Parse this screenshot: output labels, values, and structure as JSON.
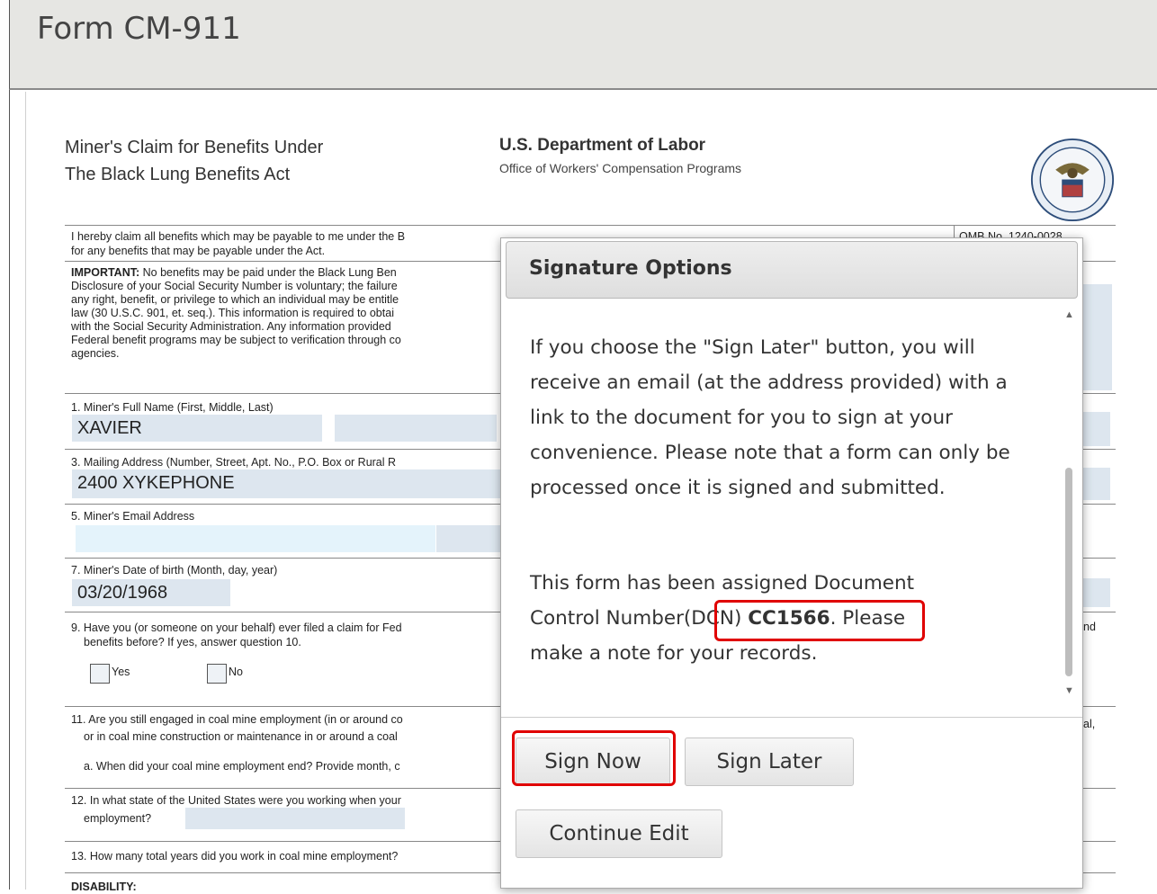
{
  "app": {
    "title": "Form CM-911"
  },
  "form": {
    "title_line1": "Miner's Claim for Benefits Under",
    "title_line2": "The Black Lung Benefits Act",
    "department": "U.S. Department of Labor",
    "office": "Office of Workers' Compensation Programs",
    "seal_alt": "department-of-labor-seal",
    "intro_line1": "I hereby claim all benefits which may be payable to me under the B",
    "intro_line2": "for any benefits that may be payable under the Act.",
    "omb": "OMB No. 1240-0028",
    "important_label": "IMPORTANT:",
    "important_lines": [
      " No benefits may be paid under the Black Lung Ben",
      "Disclosure of your Social Security Number is voluntary; the failure",
      "any right, benefit, or privilege to which an individual may be entitle",
      "law (30 U.S.C. 901, et. seq.). This information is required to obtai",
      "with the Social Security Administration. Any information provided",
      "Federal benefit programs may be subject to verification through co",
      "agencies."
    ],
    "q1_label": "1. Miner's Full Name (First, Middle, Last)",
    "q1_value": "XAVIER",
    "q3_label": "3. Mailing Address (Number, Street, Apt. No., P.O. Box or Rural R",
    "q3_value": "2400 XYKEPHONE",
    "q5_label": "5. Miner's Email Address",
    "q5_value": "",
    "q7_label": "7. Miner's Date of birth (Month, day, year)",
    "q7_value": "03/20/1968",
    "q9_label_line1": "9. Have you (or someone on your behalf) ever filed a claim for Fed",
    "q9_label_line2": "benefits before? If yes, answer question 10.",
    "q9_yes": "Yes",
    "q9_no": "No",
    "right_fragment_nd": "nd",
    "right_fragment_al": "al,",
    "q11_line1": "11. Are you still engaged in coal mine employment (in or around co",
    "q11_line2": "or in coal mine construction or maintenance in or around a coal",
    "q11a": "a. When did your coal mine employment end? Provide month, c",
    "q12_line1": "12. In what state of the United States were you working when your",
    "q12_line2": "employment?",
    "q13": "13.  How many total years did you work in coal mine employment?",
    "disability": "DISABILITY:"
  },
  "modal": {
    "title": "Signature Options",
    "paragraph1": "If you choose the \"Sign Later\" button, you will receive an email (at the address provided) with a link to the document for you to sign at your convenience. Please note that a form can only be processed once it is signed and submitted.",
    "p2_line1": "This form has been assigned Document",
    "p2_control": "Control Number",
    "p2_dcn_prefix": "(DCN) ",
    "p2_dcn": "CC1566",
    "p2_period": ".",
    "p2_please": " Please",
    "p2_line3": "make a note for your records.",
    "sign_now": "Sign Now",
    "sign_later": "Sign Later",
    "continue_edit": "Continue Edit"
  },
  "highlight_color": "#e00000"
}
